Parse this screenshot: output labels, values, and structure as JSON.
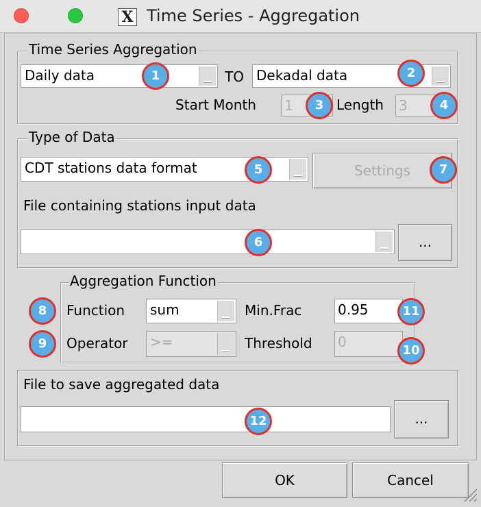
{
  "window": {
    "title": "Time Series - Aggregation"
  },
  "aggregation_group": {
    "legend": "Time Series Aggregation",
    "from_value": "Daily data",
    "to_label": "TO",
    "to_value": "Dekadal data",
    "start_month_label": "Start Month",
    "start_month_value": "1",
    "length_label": "Length",
    "length_value": "3"
  },
  "data_type_group": {
    "legend": "Type of Data",
    "format_value": "CDT stations data format",
    "settings_label": "Settings",
    "file_label": "File containing stations input data",
    "file_value": "",
    "browse_label": "..."
  },
  "function_group": {
    "legend": "Aggregation Function",
    "function_label": "Function",
    "function_value": "sum",
    "minfrac_label": "Min.Frac",
    "minfrac_value": "0.95",
    "operator_label": "Operator",
    "operator_value": ">=",
    "threshold_label": "Threshold",
    "threshold_value": "0"
  },
  "save_group": {
    "label": "File to save aggregated data",
    "file_value": "",
    "browse_label": "..."
  },
  "buttons": {
    "ok": "OK",
    "cancel": "Cancel"
  },
  "callouts": [
    "1",
    "2",
    "3",
    "4",
    "5",
    "6",
    "7",
    "8",
    "9",
    "10",
    "11",
    "12"
  ],
  "colors": {
    "callout_fill": "#5aaee8",
    "callout_border": "#e0302a"
  }
}
